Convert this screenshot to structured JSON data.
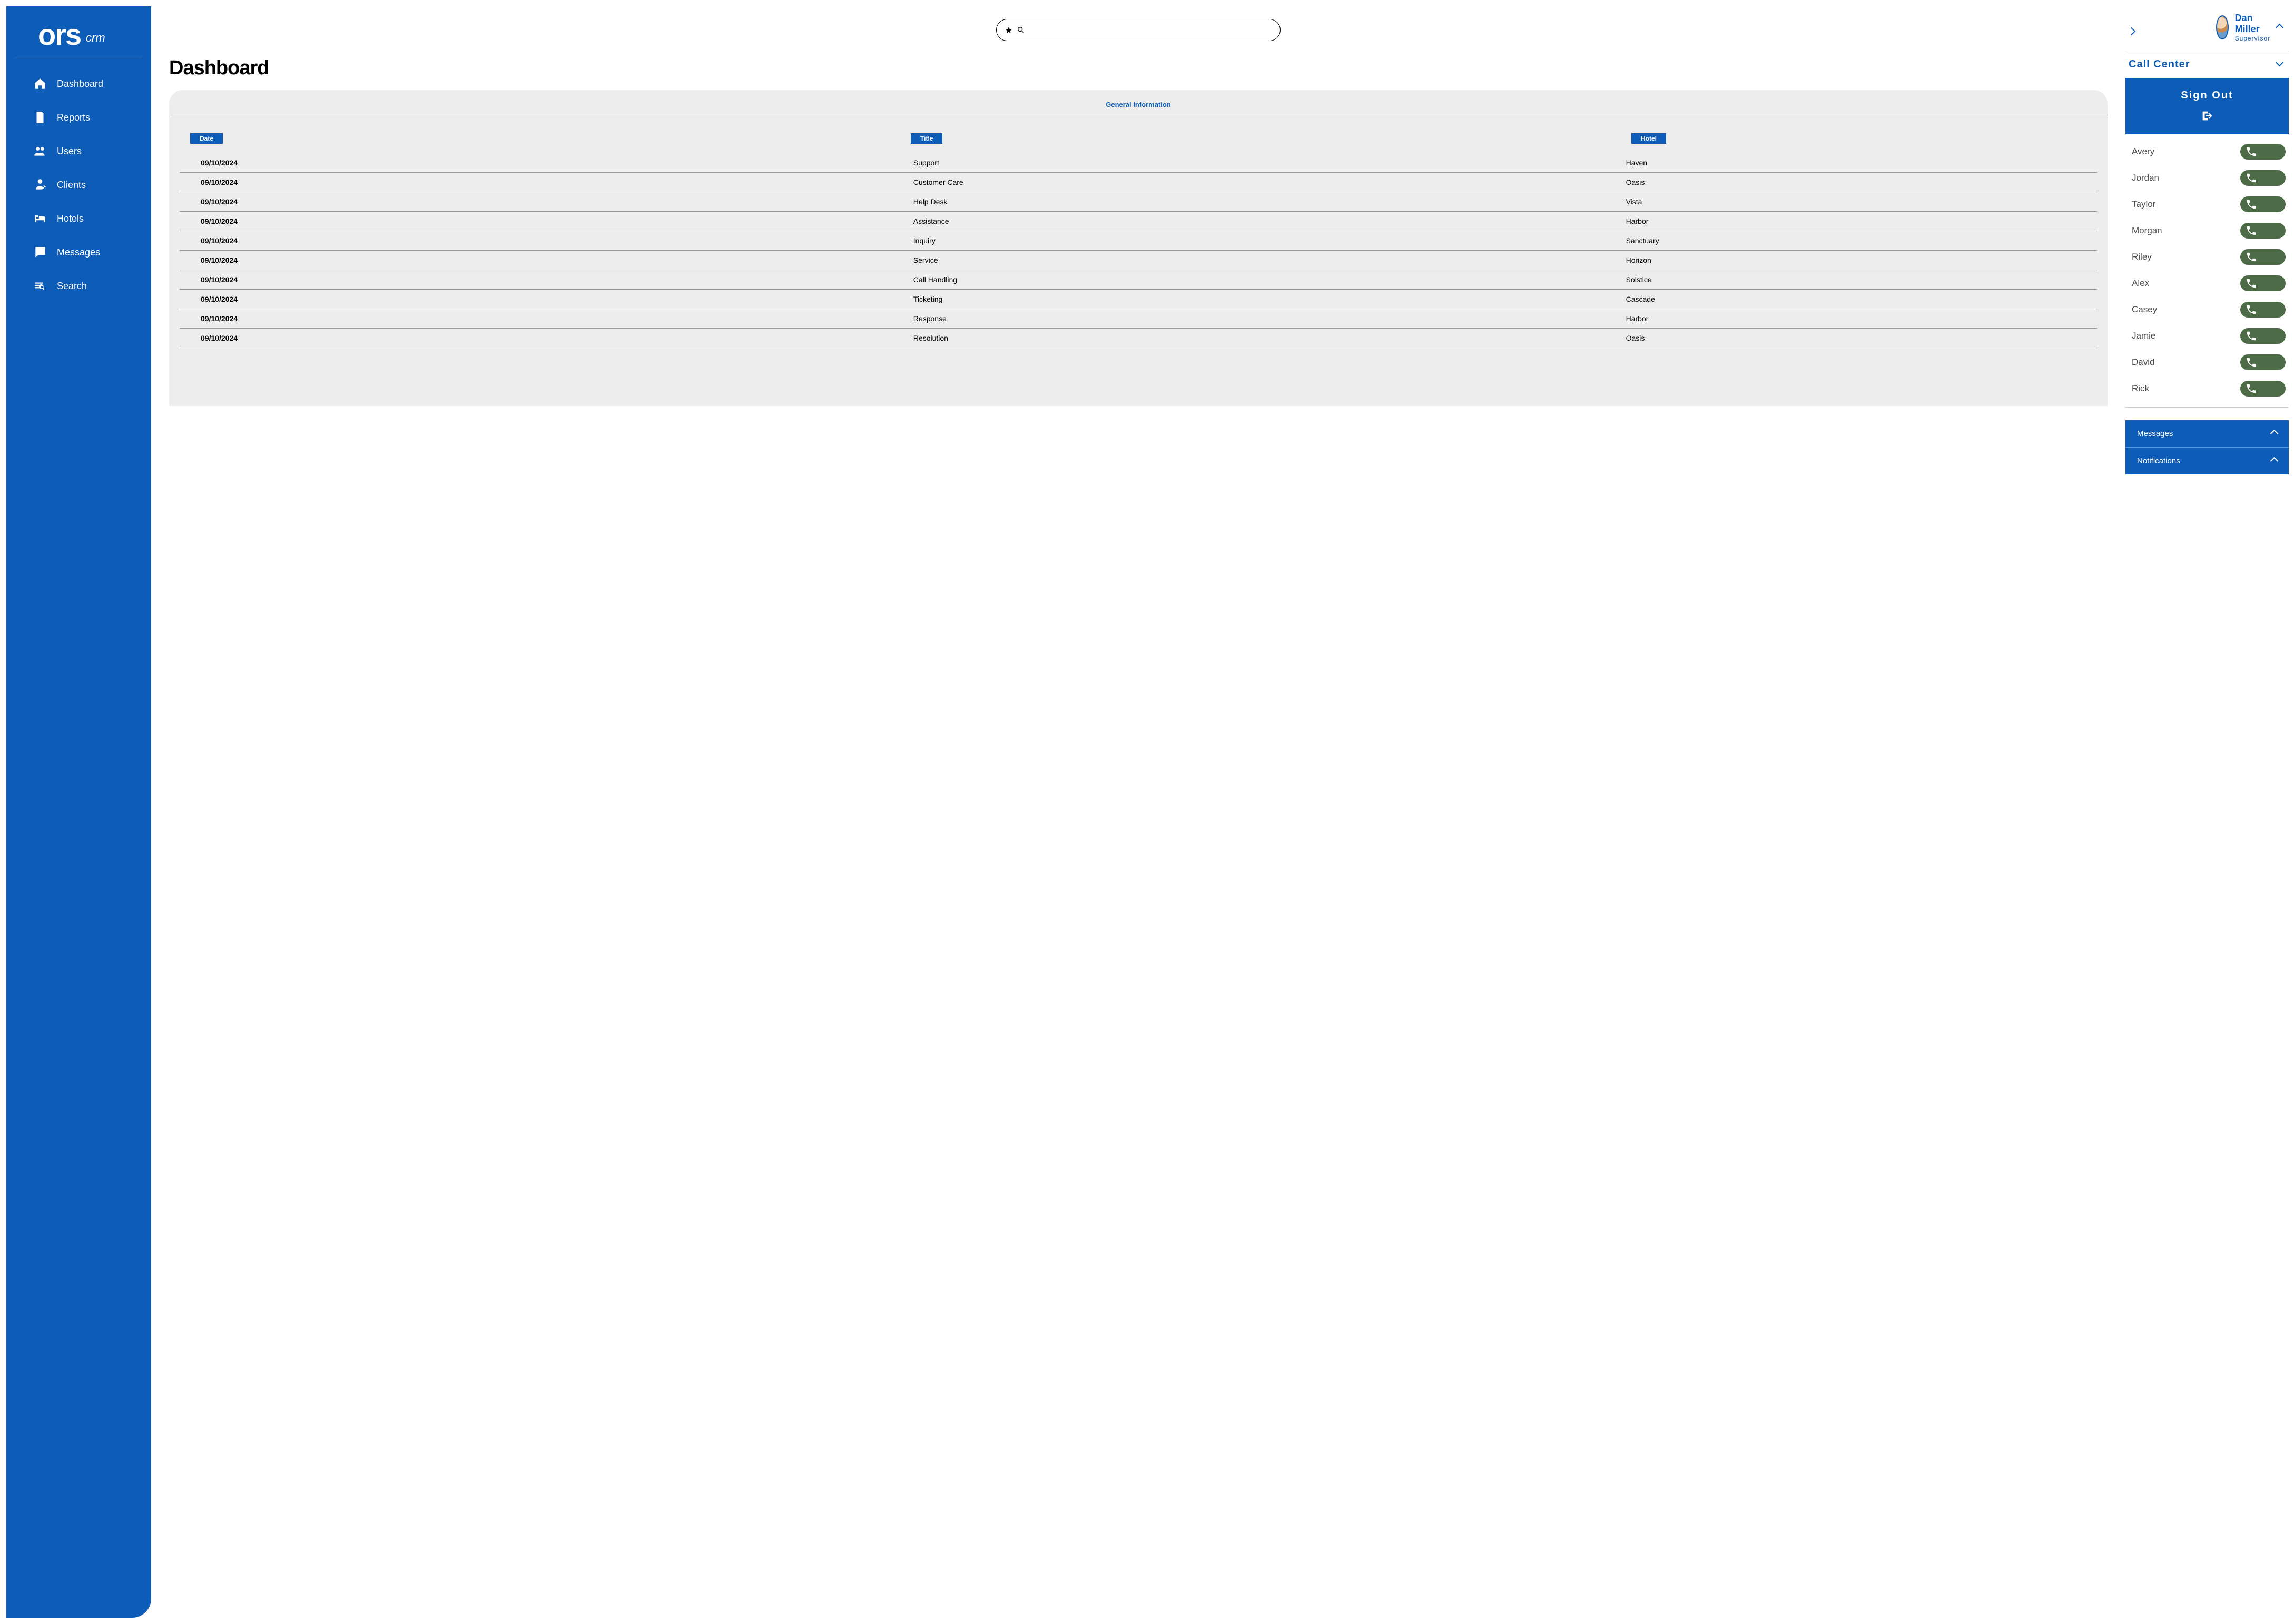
{
  "brand": {
    "name": "ors",
    "suffix": "crm"
  },
  "sidebar": {
    "items": [
      {
        "label": "Dashboard"
      },
      {
        "label": "Reports"
      },
      {
        "label": "Users"
      },
      {
        "label": "Clients"
      },
      {
        "label": "Hotels"
      },
      {
        "label": "Messages"
      },
      {
        "label": "Search"
      }
    ]
  },
  "page": {
    "title": "Dashboard"
  },
  "panel": {
    "header": "General Information",
    "columns": {
      "date": "Date",
      "title": "Title",
      "hotel": "Hotel"
    },
    "rows": [
      {
        "date": "09/10/2024",
        "title": "Support",
        "hotel": "Haven"
      },
      {
        "date": "09/10/2024",
        "title": "Customer Care",
        "hotel": "Oasis"
      },
      {
        "date": "09/10/2024",
        "title": "Help Desk",
        "hotel": "Vista"
      },
      {
        "date": "09/10/2024",
        "title": "Assistance",
        "hotel": "Harbor"
      },
      {
        "date": "09/10/2024",
        "title": "Inquiry",
        "hotel": "Sanctuary"
      },
      {
        "date": "09/10/2024",
        "title": "Service",
        "hotel": "Horizon"
      },
      {
        "date": "09/10/2024",
        "title": "Call Handling",
        "hotel": "Solstice"
      },
      {
        "date": "09/10/2024",
        "title": "Ticketing",
        "hotel": "Cascade"
      },
      {
        "date": "09/10/2024",
        "title": "Response",
        "hotel": "Harbor"
      },
      {
        "date": "09/10/2024",
        "title": "Resolution",
        "hotel": "Oasis"
      }
    ]
  },
  "profile": {
    "name": "Dan Miller",
    "role": "Supervisor"
  },
  "call_center": {
    "title": "Call Center",
    "signout_label": "Sign Out",
    "agents": [
      {
        "name": "Avery"
      },
      {
        "name": "Jordan"
      },
      {
        "name": "Taylor"
      },
      {
        "name": "Morgan"
      },
      {
        "name": "Riley"
      },
      {
        "name": "Alex"
      },
      {
        "name": "Casey"
      },
      {
        "name": "Jamie"
      },
      {
        "name": "David"
      },
      {
        "name": "Rick"
      }
    ]
  },
  "drawers": {
    "messages": "Messages",
    "notifications": "Notifications"
  }
}
